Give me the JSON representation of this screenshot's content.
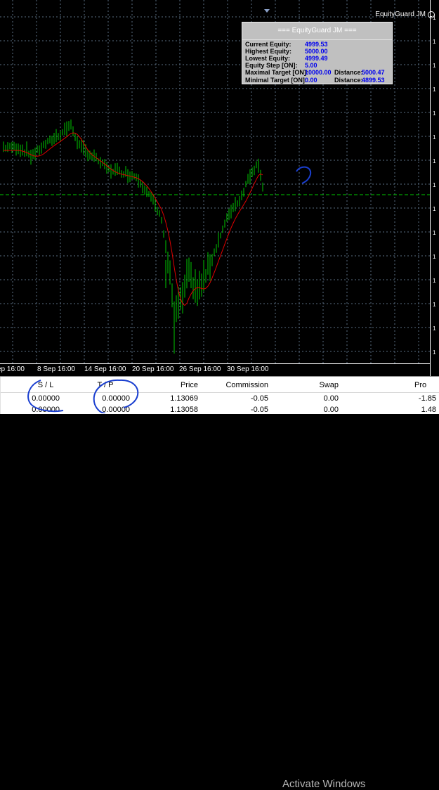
{
  "expert_label": "EquityGuard JM",
  "panel": {
    "title": "=== EquityGuard JM ===",
    "rows": [
      {
        "label": "Current Equity:",
        "value": "4999.53"
      },
      {
        "label": "Highest Equity:",
        "value": "5000.00"
      },
      {
        "label": "Lowest Equity:",
        "value": "4999.49"
      },
      {
        "label": "Equity Step [ON]:",
        "value": "5.00"
      },
      {
        "label": "Maximal Target [ON]:",
        "value": "10000.00",
        "dist_label": "Distance:",
        "dist_value": "5000.47"
      },
      {
        "label": "Minimal  Target [ON]:",
        "value": "0.00",
        "dist_label": "Distance:",
        "dist_value": "4899.53"
      }
    ],
    "colors": {
      "bg": "#c0c0c0",
      "value": "#0000ee"
    }
  },
  "time_axis": [
    "ep 16:00",
    "8 Sep 16:00",
    "14 Sep 16:00",
    "20 Sep 16:00",
    "26 Sep 16:00",
    "30 Sep 16:00"
  ],
  "price_axis": [
    "1",
    "1",
    "1",
    "1",
    "1",
    "1",
    "1",
    "1",
    "1",
    "1",
    "1",
    "1",
    "1",
    "1",
    "1"
  ],
  "colors": {
    "bars": "#00c800",
    "ma": "#e00000",
    "grid": "#5a6e82",
    "level": "#00c800",
    "annotation": "#1a3fd0"
  },
  "table": {
    "columns": [
      "S / L",
      "T / P",
      "Price",
      "Commission",
      "Swap",
      "Pro"
    ],
    "rows": [
      [
        "0.00000",
        "0.00000",
        "1.13069",
        "-0.05",
        "0.00",
        "-1.85"
      ],
      [
        "0.00000",
        "0.00000",
        "1.13058",
        "-0.05",
        "0.00",
        "1.48"
      ]
    ]
  },
  "watermark": "Activate Windows"
}
